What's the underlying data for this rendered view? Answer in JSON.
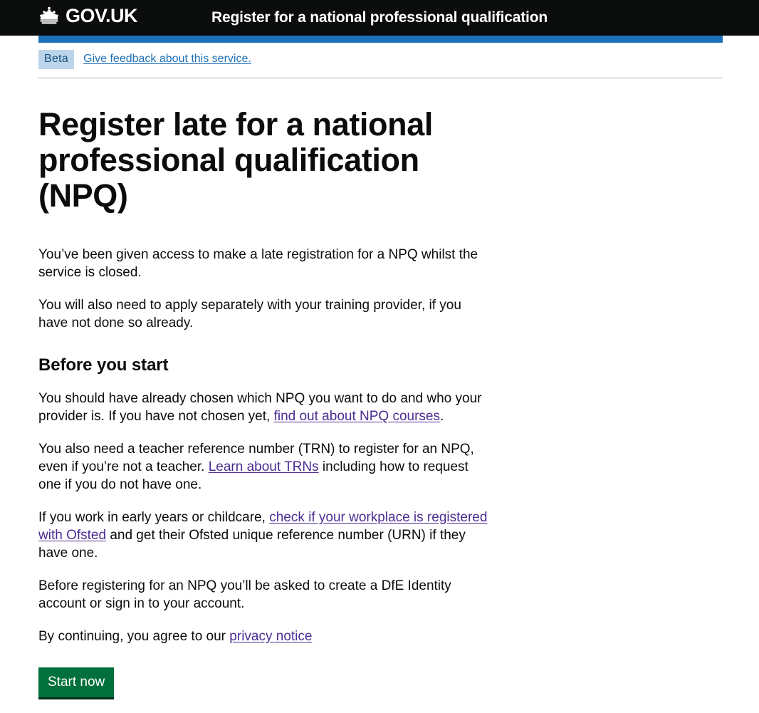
{
  "header": {
    "logo_text": "GOV.UK",
    "logo_icon": "crown-icon",
    "service_name": "Register for a national professional qualification"
  },
  "phase_banner": {
    "tag": "Beta",
    "feedback_link": "Give feedback about this service."
  },
  "main": {
    "page_title": "Register late for a national professional qualification (NPQ)",
    "intro_paragraph_1": "You’ve been given access to make a late registration for a NPQ whilst the service is closed.",
    "intro_paragraph_2": "You will also need to apply separately with your training provider, if you have not done so already.",
    "section_heading": "Before you start",
    "para_npq_prefix": "You should have already chosen which NPQ you want to do and who your provider is. If you have not chosen yet, ",
    "para_npq_link": "find out about NPQ courses",
    "para_npq_suffix": ".",
    "para_trn_prefix": "You also need a teacher reference number (TRN) to register for an NPQ, even if you’re not a teacher. ",
    "para_trn_link": "Learn about TRNs",
    "para_trn_suffix": " including how to request one if you do not have one.",
    "para_ofsted_prefix": "If you work in early years or childcare, ",
    "para_ofsted_link": "check if your workplace is registered with Ofsted",
    "para_ofsted_suffix": " and get their Ofsted unique reference number (URN) if they have one.",
    "para_dfe": "Before registering for an NPQ you’ll be asked to create a DfE Identity account or sign in to your account.",
    "para_privacy_prefix": "By continuing, you agree to our ",
    "para_privacy_link": "privacy notice",
    "start_button": "Start now"
  },
  "colors": {
    "header_background": "#0b0c0c",
    "phase_bar_blue": "#1d70b8",
    "tag_background": "#bbd4ea",
    "tag_text": "#144e81",
    "link_blue": "#1d70b8",
    "link_visited_purple": "#4c2c92",
    "button_green": "#00703c",
    "button_shadow": "#002d18",
    "body_text": "#0b0c0c"
  }
}
